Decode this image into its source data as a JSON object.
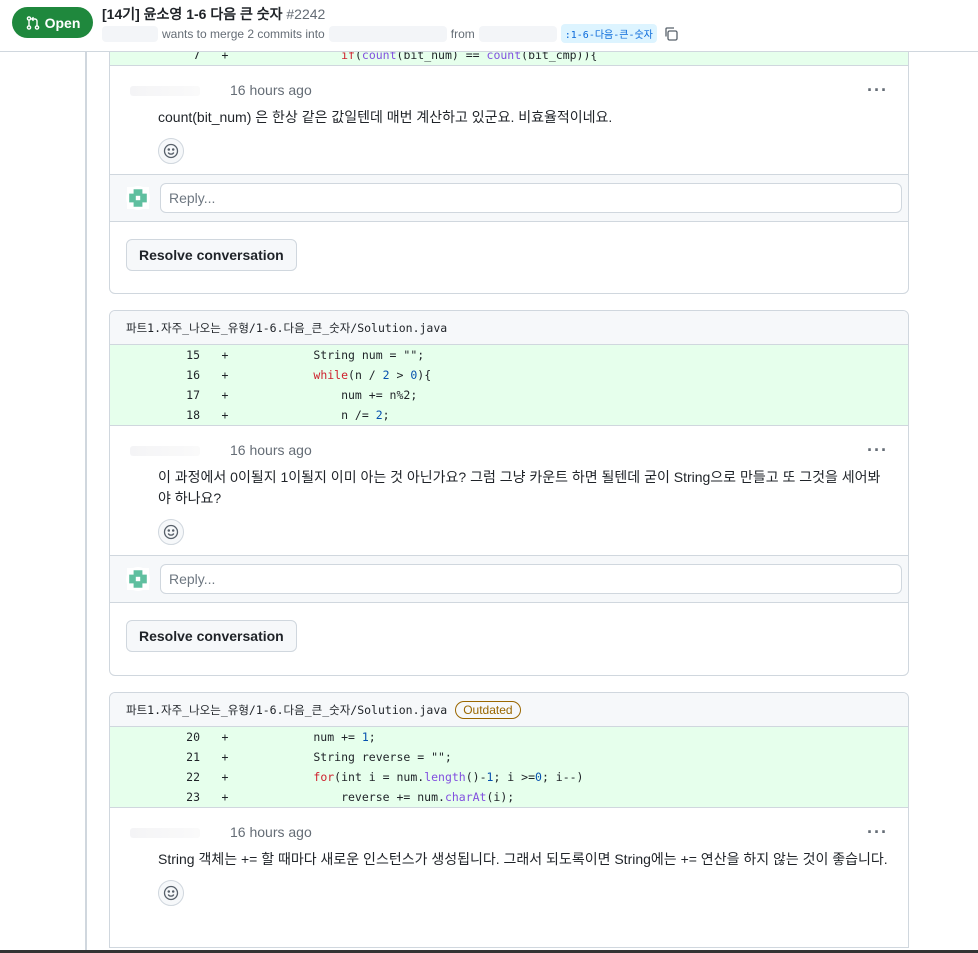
{
  "header": {
    "status": "Open",
    "title": "[14기] 윤소영 1-6 다음 큰 숫자",
    "number": "#2242",
    "meta_text": "wants to merge 2 commits into",
    "from_text": "from",
    "branch": ":1-6-다음-큰-숫자"
  },
  "threads": [
    {
      "diff_lines": [
        {
          "ln": "7",
          "sign": "+",
          "code": "            if(count(bit_num) == count(bit_cmp)){"
        }
      ],
      "comment": {
        "time": "16 hours ago",
        "body": "count(bit_num) 은 한상 같은 값일텐데 매번 계산하고 있군요. 비효율적이네요."
      },
      "reply_placeholder": "Reply...",
      "resolve_label": "Resolve conversation"
    },
    {
      "file": "파트1.자주_나오는_유형/1-6.다음_큰_숫자/Solution.java",
      "diff_lines": [
        {
          "ln": "15",
          "sign": "+",
          "code": "        String num = \"\";"
        },
        {
          "ln": "16",
          "sign": "+",
          "code": "        while(n / 2 > 0){"
        },
        {
          "ln": "17",
          "sign": "+",
          "code": "            num += n%2;"
        },
        {
          "ln": "18",
          "sign": "+",
          "code": "            n /= 2;"
        }
      ],
      "comment": {
        "time": "16 hours ago",
        "body": "이 과정에서 0이될지 1이될지 이미 아는 것 아닌가요? 그럼 그냥 카운트 하면 될텐데 굳이 String으로 만들고 또 그것을 세어봐야 하나요?"
      },
      "reply_placeholder": "Reply...",
      "resolve_label": "Resolve conversation"
    },
    {
      "file": "파트1.자주_나오는_유형/1-6.다음_큰_숫자/Solution.java",
      "badge": "Outdated",
      "diff_lines": [
        {
          "ln": "20",
          "sign": "+",
          "code": "        num += 1;"
        },
        {
          "ln": "21",
          "sign": "+",
          "code": "        String reverse = \"\";"
        },
        {
          "ln": "22",
          "sign": "+",
          "code": "        for(int i = num.length()-1; i >=0; i--)"
        },
        {
          "ln": "23",
          "sign": "+",
          "code": "            reverse += num.charAt(i);"
        }
      ],
      "comment": {
        "time": "16 hours ago",
        "body": "String 객체는 += 할 때마다 새로운 인스턴스가 생성됩니다. 그래서 되도록이면 String에는 += 연산을 하지 않는 것이 좋습니다."
      }
    }
  ],
  "colors": {
    "open": "#1f883d",
    "diff_add": "#e6ffec",
    "outdated": "#9a6700"
  }
}
